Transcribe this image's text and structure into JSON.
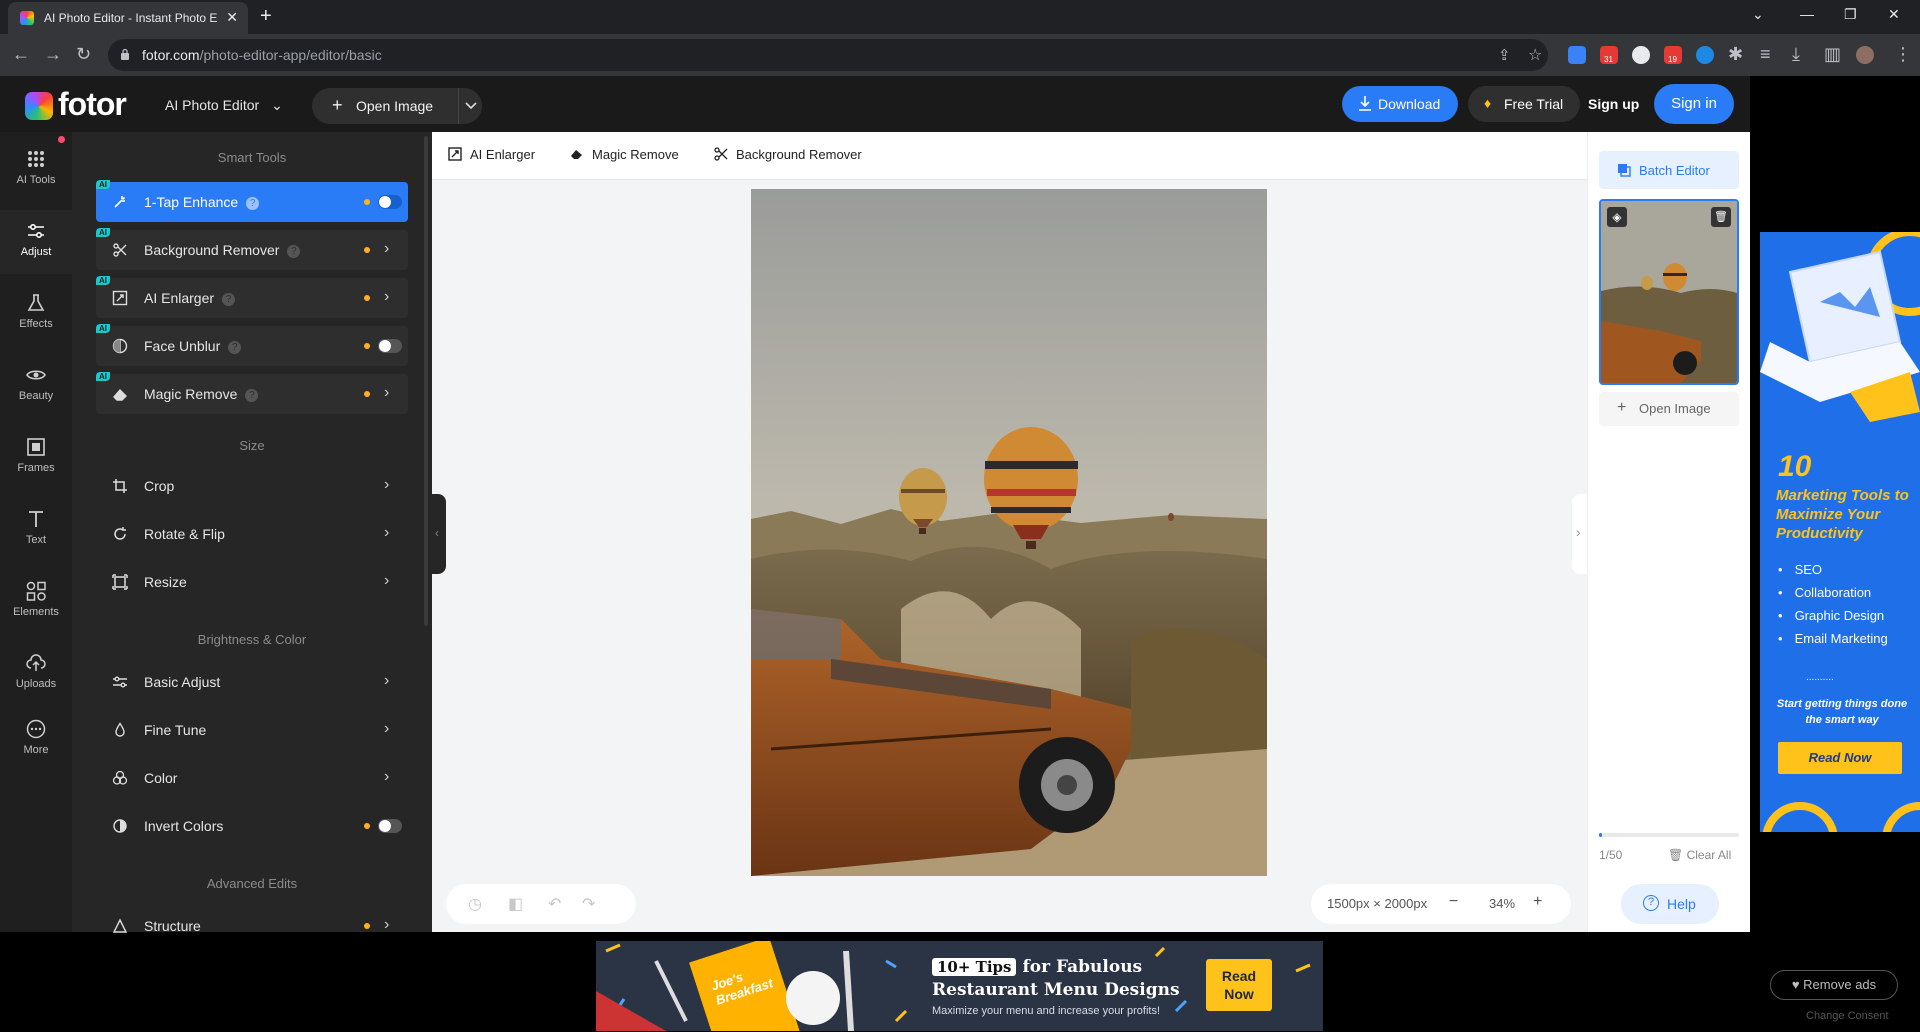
{
  "browser": {
    "tab_title": "AI Photo Editor - Instant Photo E",
    "tab_close": "✕",
    "new_tab": "+",
    "url_domain": "fotor.com",
    "url_path": "/photo-editor-app/editor/basic",
    "ext_badge_1": "31",
    "ext_badge_2": "19"
  },
  "header": {
    "logo": "fotor",
    "ai_photo_editor": "AI Photo Editor",
    "open_image": "Open Image",
    "download": "Download",
    "free_trial": "Free Trial",
    "sign_up": "Sign up",
    "sign_in": "Sign in"
  },
  "rail": {
    "items": [
      {
        "label": "AI Tools",
        "icon": "grid-icon"
      },
      {
        "label": "Adjust",
        "icon": "sliders-icon"
      },
      {
        "label": "Effects",
        "icon": "flask-icon"
      },
      {
        "label": "Beauty",
        "icon": "eye-icon"
      },
      {
        "label": "Frames",
        "icon": "frame-icon"
      },
      {
        "label": "Text",
        "icon": "text-icon"
      },
      {
        "label": "Elements",
        "icon": "shapes-icon"
      },
      {
        "label": "Uploads",
        "icon": "upload-icon"
      },
      {
        "label": "More",
        "icon": "more-icon"
      }
    ]
  },
  "panel": {
    "smart_tools_title": "Smart Tools",
    "size_title": "Size",
    "brightness_title": "Brightness & Color",
    "advanced_title": "Advanced Edits",
    "ai_badge": "AI",
    "help_mark": "?",
    "smart_tools": [
      {
        "label": "1-Tap Enhance",
        "control": "toggle",
        "active": true
      },
      {
        "label": "Background Remover",
        "control": "chevron"
      },
      {
        "label": "AI Enlarger",
        "control": "chevron"
      },
      {
        "label": "Face Unblur",
        "control": "toggle"
      },
      {
        "label": "Magic Remove",
        "control": "chevron"
      }
    ],
    "size_tools": [
      "Crop",
      "Rotate & Flip",
      "Resize"
    ],
    "color_tools": [
      "Basic Adjust",
      "Fine Tune",
      "Color",
      "Invert Colors"
    ],
    "advanced_tools": [
      "Structure"
    ]
  },
  "quickbar": {
    "ai_enlarger": "AI Enlarger",
    "magic_remove": "Magic Remove",
    "background_remover": "Background Remover"
  },
  "canvas": {
    "dimensions": "1500px × 2000px",
    "zoom": "34%",
    "zoom_out": "−",
    "zoom_in": "+"
  },
  "right_panel": {
    "batch_editor": "Batch Editor",
    "open_image": "Open Image",
    "count": "1/50",
    "progress_fraction": 0.02,
    "clear_all": "Clear All",
    "help": "Help"
  },
  "side_ad": {
    "number": "10",
    "headline": "Marketing Tools to Maximize Your Productivity",
    "bullets": [
      "SEO",
      "Collaboration",
      "Graphic Design",
      "Email Marketing"
    ],
    "more": "..........",
    "subline": "Start getting things done the smart way",
    "cta": "Read Now"
  },
  "bottom_ad": {
    "menu_card": "Joe's Breakfast",
    "badge": "10+ Tips",
    "line1": "for Fabulous",
    "line2": "Restaurant Menu Designs",
    "line3": "Maximize your menu and increase your profits!",
    "cta": "Read Now"
  },
  "footer": {
    "remove_ads": "Remove ads",
    "change_consent": "Change Consent"
  },
  "colors": {
    "accent": "#2a7cf6",
    "panel_bg": "#262626",
    "header_bg": "#1a1a1a",
    "ad_yellow": "#ffc21a"
  }
}
